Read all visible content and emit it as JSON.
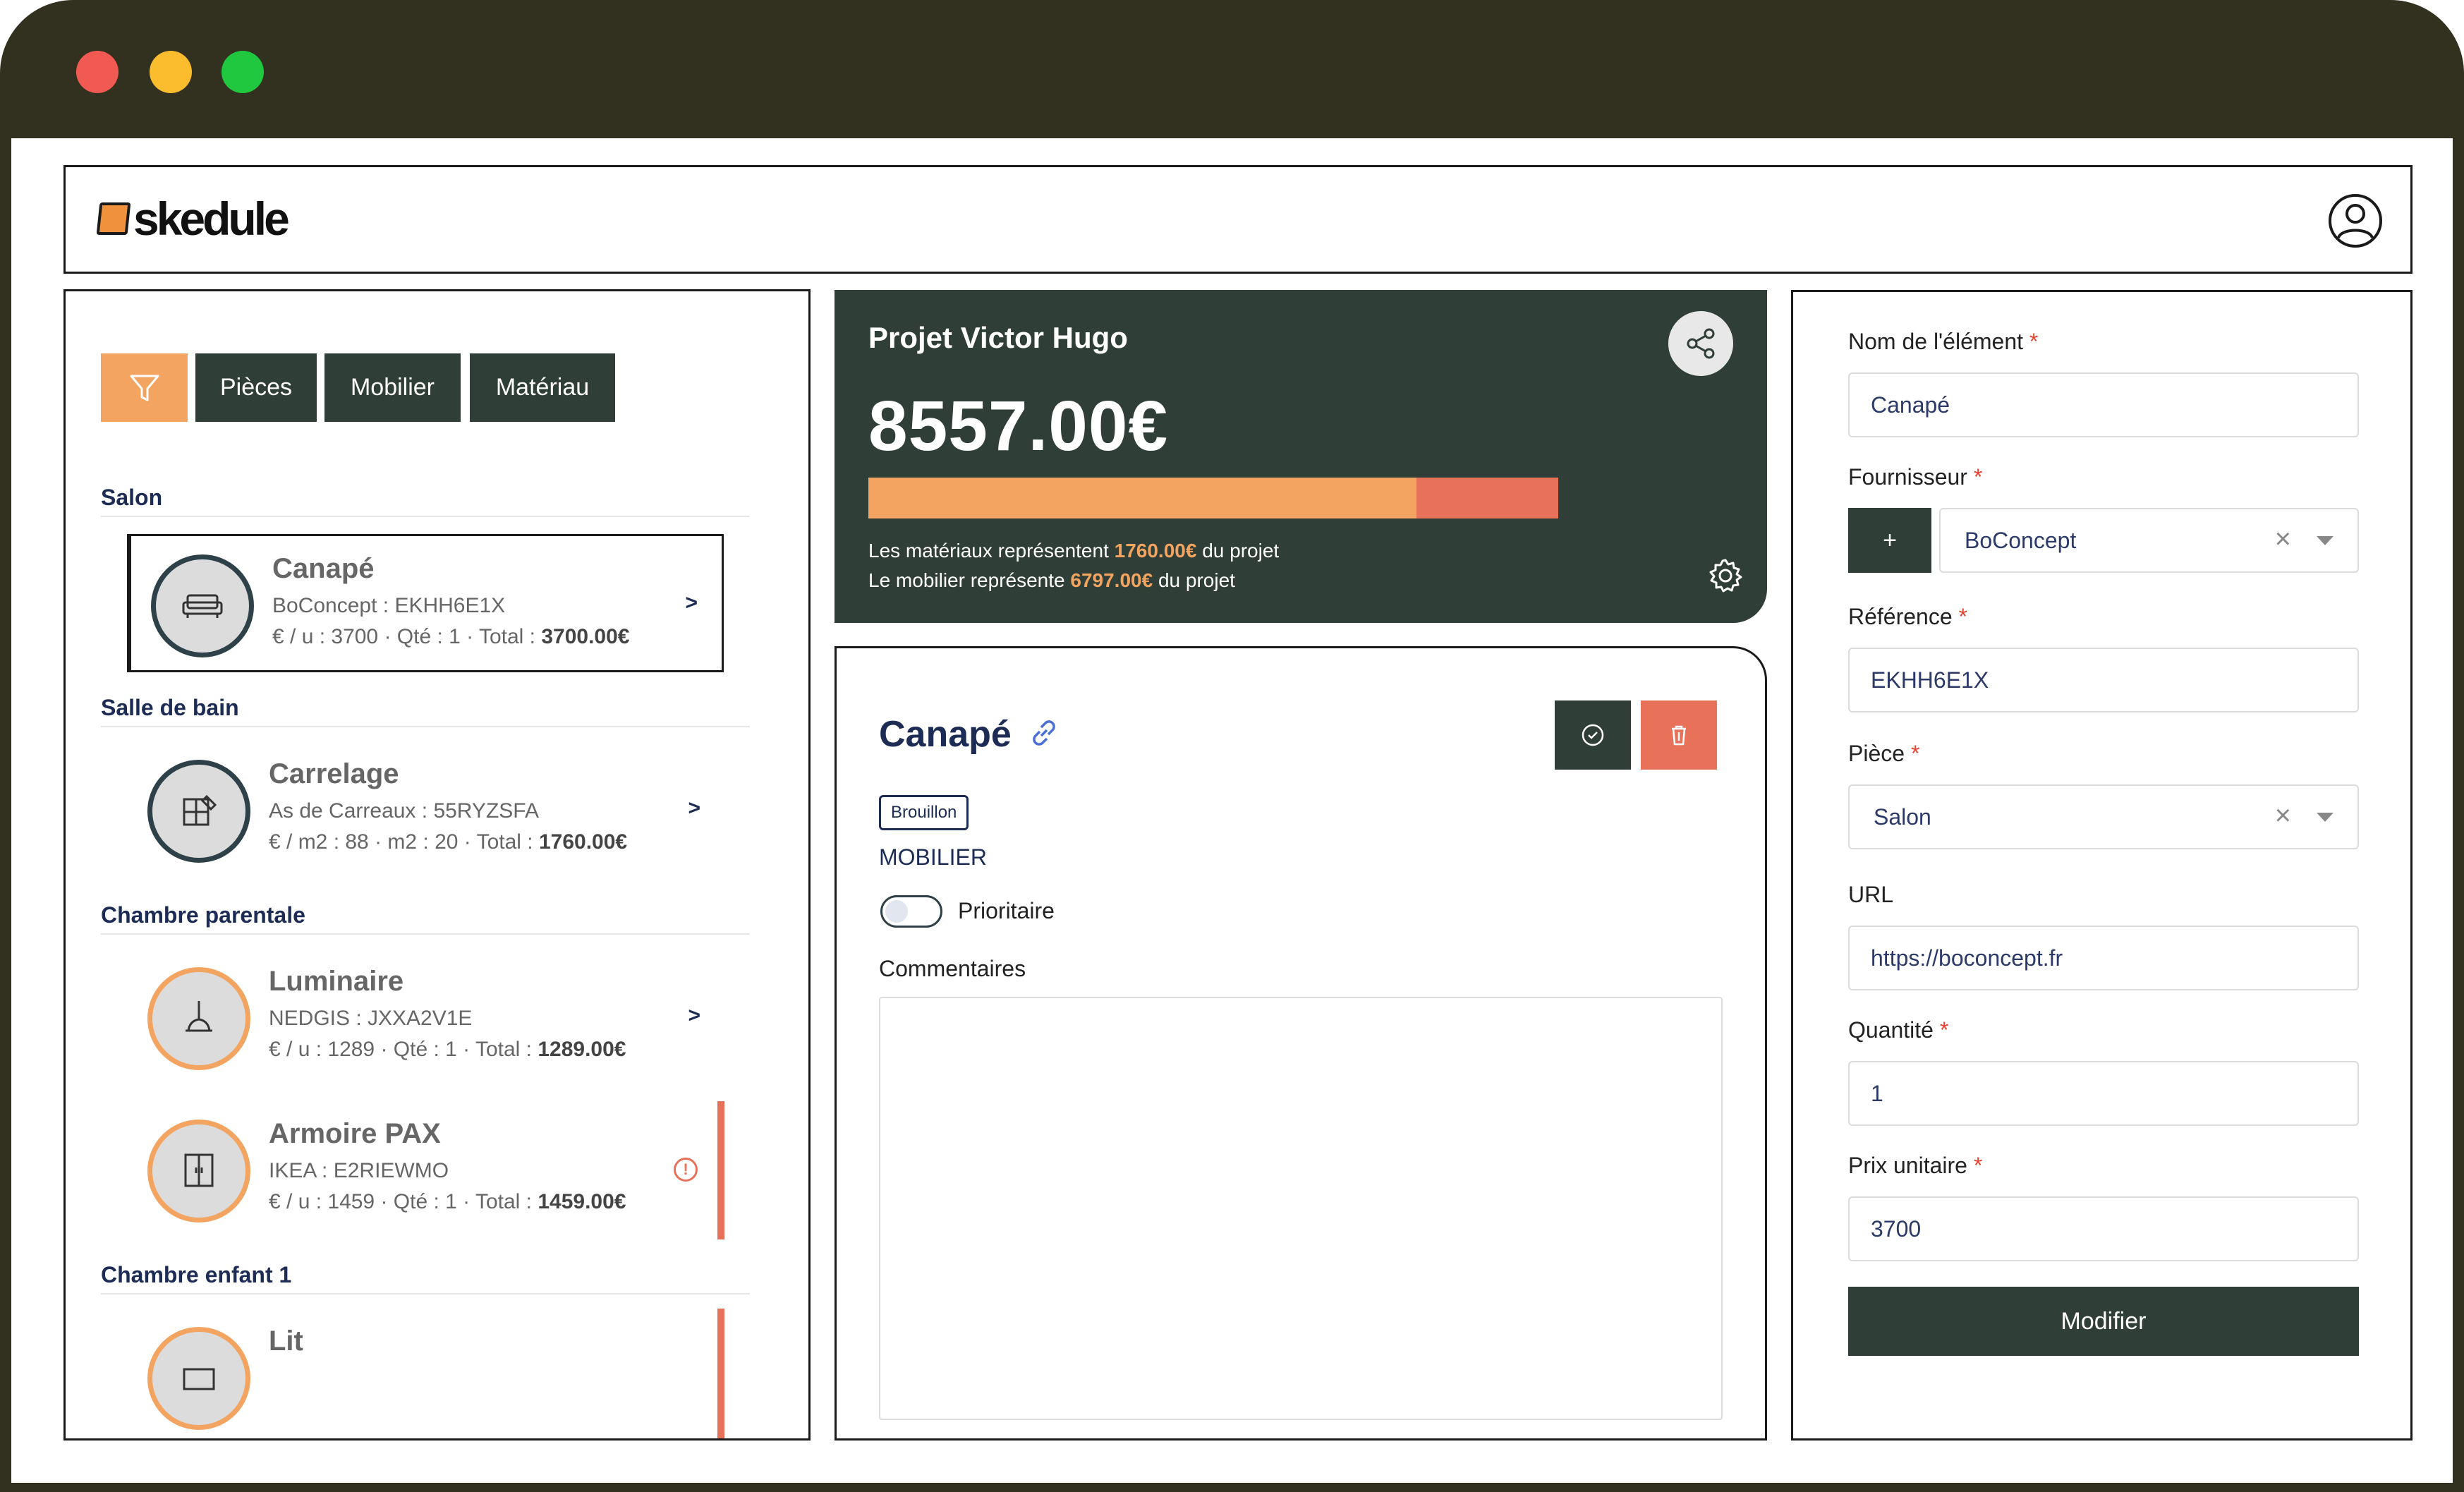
{
  "app": {
    "logo_text": "skedule"
  },
  "filters": {
    "tabs": [
      "Pièces",
      "Mobilier",
      "Matériau"
    ]
  },
  "sections": [
    {
      "title": "Salon",
      "items": [
        {
          "name": "Canapé",
          "supplier_ref": "BoConcept : EKHH6E1X",
          "price_prefix": "€ / u : 3700 · Qté : 1 · Total : ",
          "total": "3700.00€",
          "icon": "sofa-icon",
          "chevron": ">"
        }
      ]
    },
    {
      "title": "Salle de bain",
      "items": [
        {
          "name": "Carrelage",
          "supplier_ref": "As de Carreaux : 55RYZSFA",
          "price_prefix": "€ / m2 : 88 · m2 : 20 · Total : ",
          "total": "1760.00€",
          "icon": "tiles-icon",
          "chevron": ">"
        }
      ]
    },
    {
      "title": "Chambre parentale",
      "items": [
        {
          "name": "Luminaire",
          "supplier_ref": "NEDGIS : JXXA2V1E",
          "price_prefix": "€ / u : 1289 · Qté : 1 · Total : ",
          "total": "1289.00€",
          "icon": "lamp-icon",
          "chevron": ">"
        },
        {
          "name": "Armoire PAX",
          "supplier_ref": "IKEA : E2RIEWMO",
          "price_prefix": "€ / u : 1459 · Qté : 1 · Total : ",
          "total": "1459.00€",
          "icon": "wardrobe-icon",
          "warning": "!"
        }
      ]
    },
    {
      "title": "Chambre enfant 1",
      "items": [
        {
          "name": "Lit",
          "icon": "bed-icon"
        }
      ]
    }
  ],
  "project": {
    "title": "Projet Victor Hugo",
    "total": "8557.00€",
    "materials_share": 0.794,
    "line1": {
      "before": "Les matériaux représentent ",
      "amount": "1760.00€",
      "after": " du projet"
    },
    "line2": {
      "before": "Le mobilier représente ",
      "amount": "6797.00€",
      "after": " du projet"
    }
  },
  "detail": {
    "title": "Canapé",
    "badge": "Brouillon",
    "category": "MOBILIER",
    "toggle_label": "Prioritaire",
    "toggle_on": false,
    "comments_label": "Commentaires",
    "comments_value": ""
  },
  "form": {
    "name_label": "Nom de l'élément",
    "name_value": "Canapé",
    "supplier_label": "Fournisseur",
    "add_label": "+",
    "supplier_value": "BoConcept",
    "reference_label": "Référence",
    "reference_value": "EKHH6E1X",
    "room_label": "Pièce",
    "room_value": "Salon",
    "url_label": "URL",
    "url_value": "https://boconcept.fr",
    "quantity_label": "Quantité",
    "quantity_value": "1",
    "price_label": "Prix unitaire",
    "price_value": "3700",
    "required_mark": "*",
    "clear_mark": "×",
    "submit_label": "Modifier"
  },
  "colors": {
    "dark_green": "#2f3f37",
    "orange": "#f2a460",
    "coral": "#e8715a",
    "navy": "#1d2c55"
  }
}
